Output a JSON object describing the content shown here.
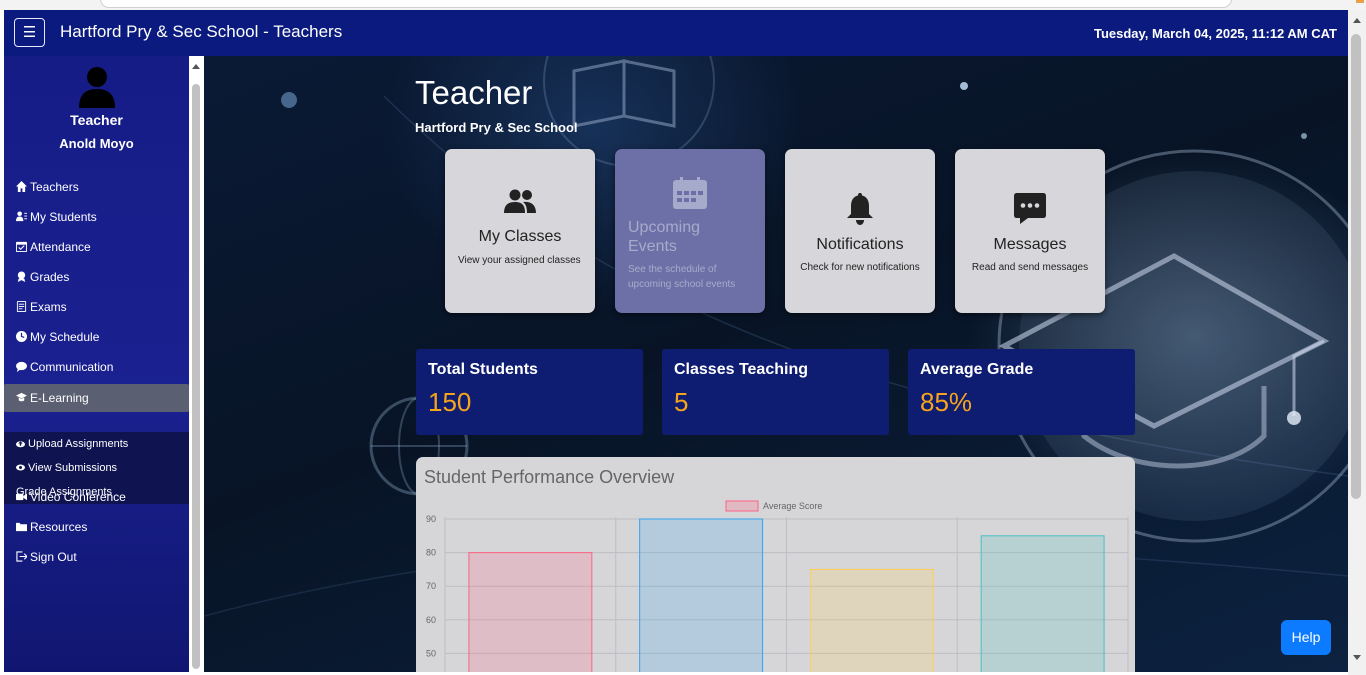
{
  "header": {
    "title": "Hartford Pry & Sec School - Teachers",
    "datetime": "Tuesday, March 04, 2025, 11:12 AM CAT",
    "menu_icon": "hamburger-icon"
  },
  "sidebar": {
    "role": "Teacher",
    "user_name": "Anold Moyo",
    "items": [
      {
        "label": "Teachers",
        "icon": "home-icon"
      },
      {
        "label": "My Students",
        "icon": "users-icon"
      },
      {
        "label": "Attendance",
        "icon": "calendar-check-icon"
      },
      {
        "label": "Grades",
        "icon": "award-icon"
      },
      {
        "label": "Exams",
        "icon": "file-icon"
      },
      {
        "label": "My Schedule",
        "icon": "clock-icon"
      },
      {
        "label": "Communication",
        "icon": "chat-icon"
      },
      {
        "label": "E-Learning",
        "icon": "graduation-cap-icon",
        "active": true
      },
      {
        "label": "Video Conference",
        "icon": "video-icon"
      },
      {
        "label": "Resources",
        "icon": "folder-icon"
      },
      {
        "label": "Sign Out",
        "icon": "sign-out-icon"
      }
    ],
    "elearning_sub": [
      {
        "label": "Upload Assignments",
        "icon": "upload-cloud-icon"
      },
      {
        "label": "View Submissions",
        "icon": "eye-icon"
      },
      {
        "label": "Grade Assignments"
      }
    ]
  },
  "main": {
    "title": "Teacher",
    "school": "Hartford Pry & Sec School",
    "cards": [
      {
        "title": "My Classes",
        "desc": "View your assigned classes",
        "icon": "users-icon"
      },
      {
        "title": "Upcoming Events",
        "desc": "See the schedule of upcoming school events",
        "icon": "calendar-icon"
      },
      {
        "title": "Notifications",
        "desc": "Check for new notifications",
        "icon": "bell-icon"
      },
      {
        "title": "Messages",
        "desc": "Read and send messages",
        "icon": "message-icon"
      }
    ],
    "stats": [
      {
        "label": "Total Students",
        "value": "150"
      },
      {
        "label": "Classes Teaching",
        "value": "5"
      },
      {
        "label": "Average Grade",
        "value": "85%"
      }
    ],
    "chart_title": "Student Performance Overview"
  },
  "chart_data": {
    "type": "bar",
    "title": "Student Performance Overview",
    "series": [
      {
        "name": "Average Score",
        "values": [
          80,
          90,
          75,
          85
        ]
      }
    ],
    "colors": [
      "#ff6384",
      "#36a2eb",
      "#ffce56",
      "#4bc0c0"
    ],
    "y_ticks": [
      90,
      80,
      70,
      60,
      50
    ],
    "grid": true,
    "legend": "top"
  },
  "help": {
    "label": "Help"
  },
  "colors": {
    "header_bg": "#0a1a7e",
    "sidebar_bg": "#161c86",
    "stat_bg": "#0e1c72",
    "stat_value": "#f6a41c",
    "help_bg": "#0d7bff"
  }
}
